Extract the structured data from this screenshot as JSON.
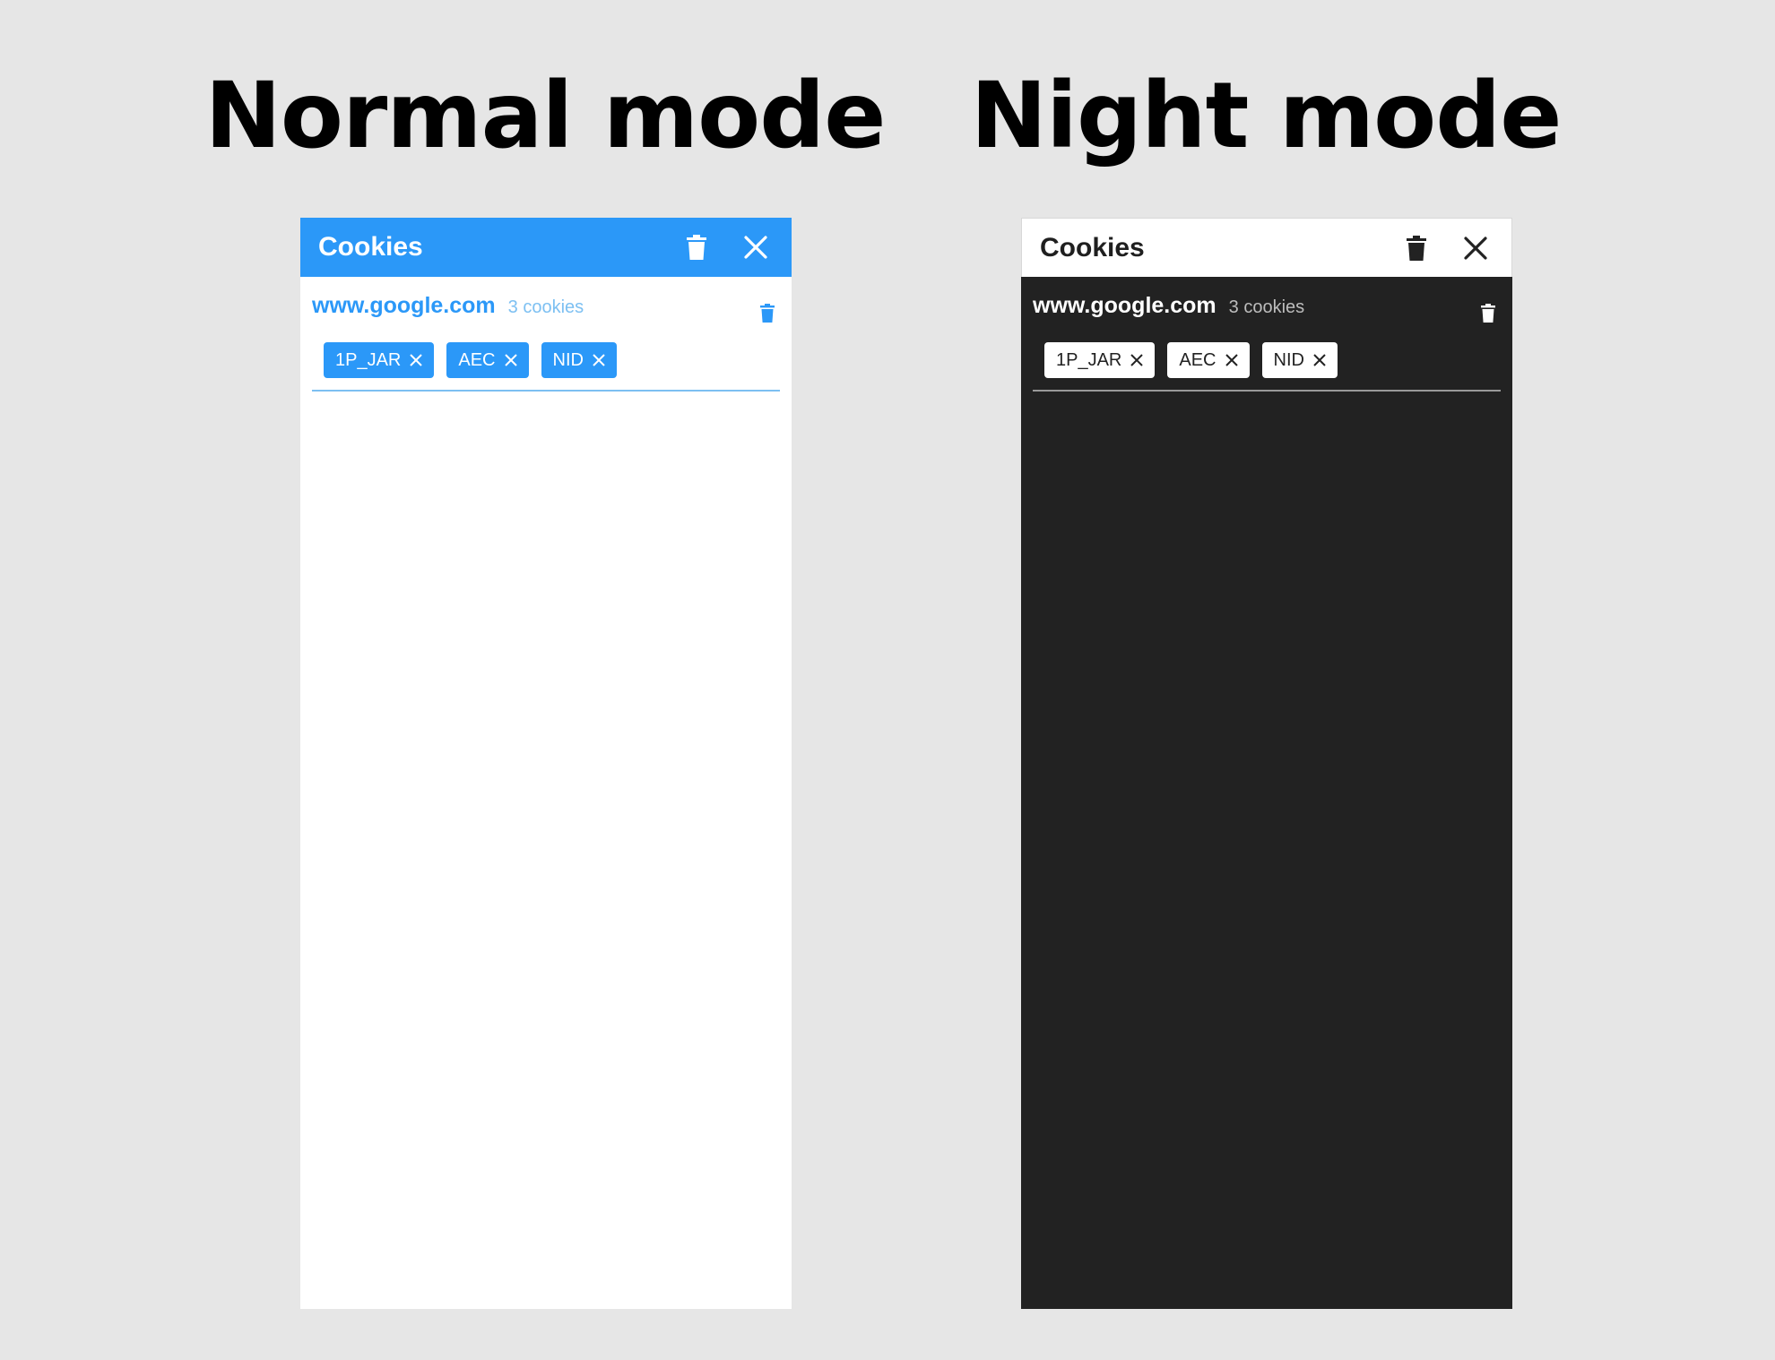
{
  "headings": {
    "left": "Normal mode",
    "right": "Night mode"
  },
  "panels": [
    {
      "mode": "normal",
      "title": "Cookies",
      "header_icons": [
        "trash-icon",
        "close-icon"
      ],
      "site": {
        "domain": "www.google.com",
        "count": "3 cookies",
        "cookies": [
          "1P_JAR",
          "AEC",
          "NID"
        ]
      }
    },
    {
      "mode": "night",
      "title": "Cookies",
      "header_icons": [
        "trash-icon",
        "close-icon"
      ],
      "site": {
        "domain": "www.google.com",
        "count": "3 cookies",
        "cookies": [
          "1P_JAR",
          "AEC",
          "NID"
        ]
      }
    }
  ],
  "colors": {
    "page_background": "#e6e6e6",
    "accent_blue": "#2b98f8",
    "light_blue": "#7dc0f2",
    "night_background": "#222222",
    "white": "#ffffff"
  }
}
